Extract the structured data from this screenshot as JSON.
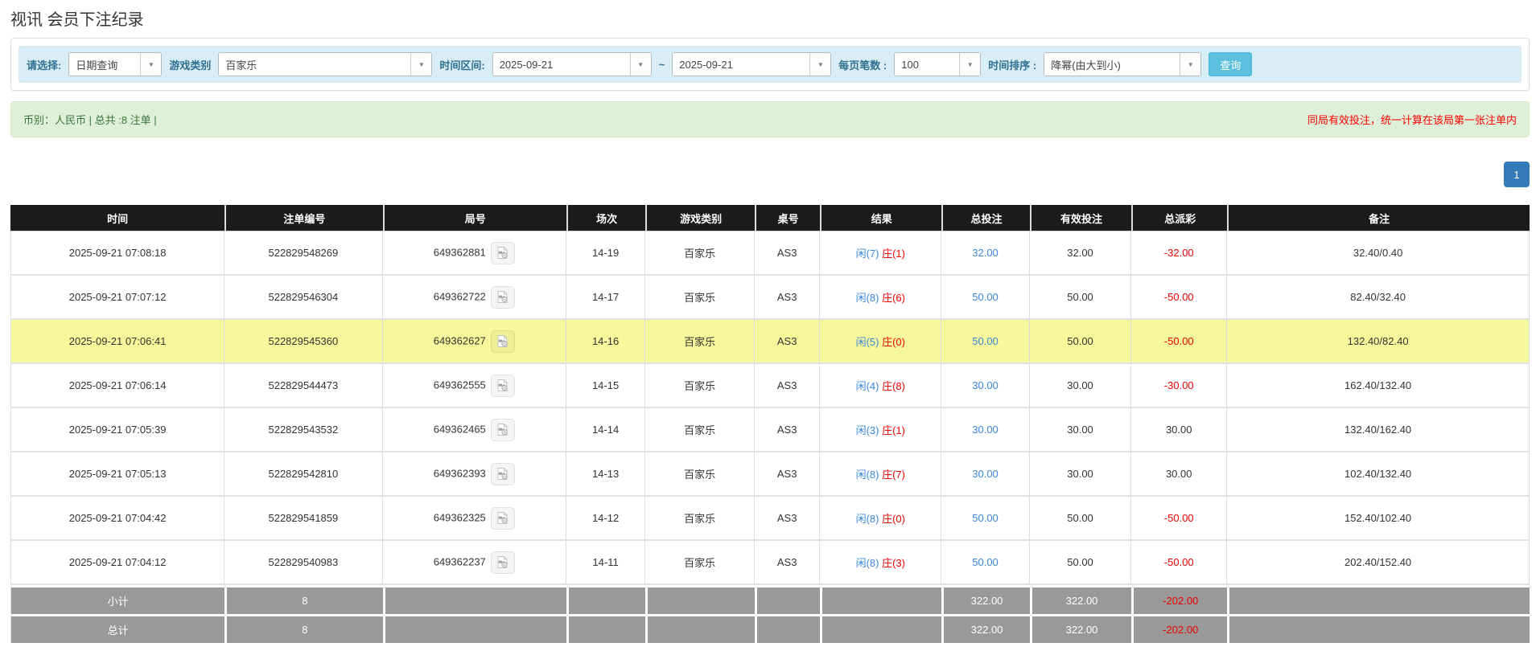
{
  "title": "视讯 会员下注纪录",
  "filters": {
    "query_type": {
      "label": "请选择:",
      "value": "日期查询"
    },
    "game_category": {
      "label": "游戏类别",
      "value": "百家乐"
    },
    "date_range": {
      "label": "时间区间:",
      "from": "2025-09-21",
      "to": "2025-09-21",
      "separator": "~"
    },
    "page_size": {
      "label": "每页笔数 :",
      "value": "100"
    },
    "sort_order": {
      "label": "时间排序 :",
      "value": "降幂(由大到小)"
    },
    "search_label": "查询",
    "dropdown_arrow": "▼"
  },
  "info": {
    "summary": "币别：人民币 | 总共 :8 注单 |",
    "notice": "同局有效投注，统一计算在该局第一张注单内"
  },
  "pagination": {
    "current_page": "1"
  },
  "table": {
    "columns": [
      {
        "key": "time",
        "label": "时间"
      },
      {
        "key": "bet-id",
        "label": "注单编号"
      },
      {
        "key": "round",
        "label": "局号"
      },
      {
        "key": "session",
        "label": "场次"
      },
      {
        "key": "game",
        "label": "游戏类别"
      },
      {
        "key": "table",
        "label": "桌号"
      },
      {
        "key": "result",
        "label": "结果"
      },
      {
        "key": "total-bet",
        "label": "总投注"
      },
      {
        "key": "valid-bet",
        "label": "有效投注"
      },
      {
        "key": "payout",
        "label": "总派彩"
      },
      {
        "key": "remark",
        "label": "备注"
      }
    ],
    "rows": [
      {
        "time": "2025-09-21 07:08:18",
        "bet_id": "522829548269",
        "round": "649362881",
        "session": "14-19",
        "game": "百家乐",
        "table_code": "AS3",
        "result_player": "闲(7)",
        "result_banker": "庄(1)",
        "total_bet": "32.00",
        "valid_bet": "32.00",
        "payout": "-32.00",
        "remark": "32.40/0.40",
        "highlighted": false
      },
      {
        "time": "2025-09-21 07:07:12",
        "bet_id": "522829546304",
        "round": "649362722",
        "session": "14-17",
        "game": "百家乐",
        "table_code": "AS3",
        "result_player": "闲(8)",
        "result_banker": "庄(6)",
        "total_bet": "50.00",
        "valid_bet": "50.00",
        "payout": "-50.00",
        "remark": "82.40/32.40",
        "highlighted": false
      },
      {
        "time": "2025-09-21 07:06:41",
        "bet_id": "522829545360",
        "round": "649362627",
        "session": "14-16",
        "game": "百家乐",
        "table_code": "AS3",
        "result_player": "闲(5)",
        "result_banker": "庄(0)",
        "total_bet": "50.00",
        "valid_bet": "50.00",
        "payout": "-50.00",
        "remark": "132.40/82.40",
        "highlighted": true
      },
      {
        "time": "2025-09-21 07:06:14",
        "bet_id": "522829544473",
        "round": "649362555",
        "session": "14-15",
        "game": "百家乐",
        "table_code": "AS3",
        "result_player": "闲(4)",
        "result_banker": "庄(8)",
        "total_bet": "30.00",
        "valid_bet": "30.00",
        "payout": "-30.00",
        "remark": "162.40/132.40",
        "highlighted": false
      },
      {
        "time": "2025-09-21 07:05:39",
        "bet_id": "522829543532",
        "round": "649362465",
        "session": "14-14",
        "game": "百家乐",
        "table_code": "AS3",
        "result_player": "闲(3)",
        "result_banker": "庄(1)",
        "total_bet": "30.00",
        "valid_bet": "30.00",
        "payout": "30.00",
        "remark": "132.40/162.40",
        "highlighted": false
      },
      {
        "time": "2025-09-21 07:05:13",
        "bet_id": "522829542810",
        "round": "649362393",
        "session": "14-13",
        "game": "百家乐",
        "table_code": "AS3",
        "result_player": "闲(8)",
        "result_banker": "庄(7)",
        "total_bet": "30.00",
        "valid_bet": "30.00",
        "payout": "30.00",
        "remark": "102.40/132.40",
        "highlighted": false
      },
      {
        "time": "2025-09-21 07:04:42",
        "bet_id": "522829541859",
        "round": "649362325",
        "session": "14-12",
        "game": "百家乐",
        "table_code": "AS3",
        "result_player": "闲(8)",
        "result_banker": "庄(0)",
        "total_bet": "50.00",
        "valid_bet": "50.00",
        "payout": "-50.00",
        "remark": "152.40/102.40",
        "highlighted": false
      },
      {
        "time": "2025-09-21 07:04:12",
        "bet_id": "522829540983",
        "round": "649362237",
        "session": "14-11",
        "game": "百家乐",
        "table_code": "AS3",
        "result_player": "闲(8)",
        "result_banker": "庄(3)",
        "total_bet": "50.00",
        "valid_bet": "50.00",
        "payout": "-50.00",
        "remark": "202.40/152.40",
        "highlighted": false
      }
    ],
    "summary_rows": [
      {
        "label": "小计",
        "count": "8",
        "total_bet": "322.00",
        "valid_bet": "322.00",
        "payout": "-202.00"
      },
      {
        "label": "总计",
        "count": "8",
        "total_bet": "322.00",
        "valid_bet": "322.00",
        "payout": "-202.00"
      }
    ]
  },
  "icons": {
    "video_replay": "video-file-icon",
    "dropdown": "chevron-down-icon"
  },
  "colors": {
    "filter_bar_bg": "#d9edf7",
    "filter_label": "#31708f",
    "search_button": "#5bc0de",
    "info_bar_bg": "#dff0d8",
    "info_text_green": "#3c763d",
    "notice_red": "#ff0000",
    "pager_blue": "#337ab7",
    "header_bg": "#1b1b1b",
    "highlight_row": "#f7f79b",
    "summary_bg": "#999999",
    "amount_blue": "#3a87dc",
    "negative_red": "#ee0000"
  }
}
